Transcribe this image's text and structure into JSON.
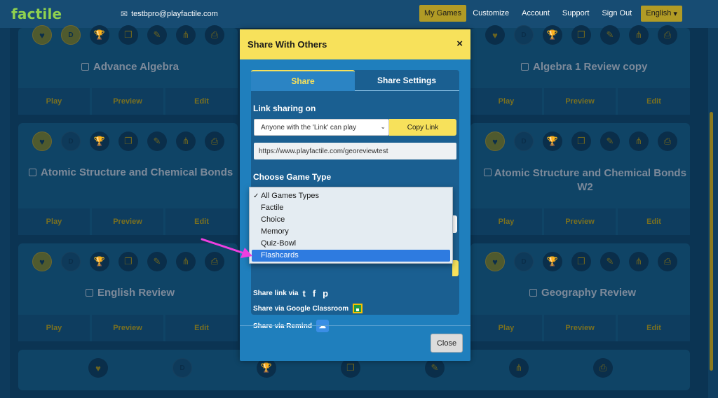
{
  "navbar": {
    "logo": "factile",
    "email": "testbpro@playfactile.com",
    "links": [
      "My Games",
      "Customize",
      "Account",
      "Support",
      "Sign Out"
    ],
    "language": "English"
  },
  "cards": {
    "col1": [
      "Advance Algebra",
      "Atomic Structure and Chemical Bonds",
      "English Review"
    ],
    "col3": [
      "Algebra 1 Review copy",
      "Atomic Structure and Chemical Bonds W2",
      "Geography Review"
    ],
    "actions": {
      "play": "Play",
      "preview": "Preview",
      "edit": "Edit"
    },
    "d_label": "D"
  },
  "modal": {
    "title": "Share With Others",
    "close_x": "×",
    "tabs": [
      "Share",
      "Share Settings"
    ],
    "link_sharing_label": "Link sharing on",
    "link_sharing_value": "Anyone with the 'Link' can play",
    "copy_link": "Copy Link",
    "url": "https://www.playfactile.com/georeviewtest",
    "choose_game_type": "Choose Game Type",
    "share_link_via": "Share link via",
    "share_google_classroom": "Share via Google Classroom",
    "share_remind": "Share via Remind",
    "close_button": "Close"
  },
  "game_type_dropdown": {
    "options": [
      "All Games Types",
      "Factile",
      "Choice",
      "Memory",
      "Quiz-Bowl",
      "Flashcards"
    ],
    "checked": "All Games Types",
    "highlighted": "Flashcards"
  },
  "colors": {
    "navbar": "#174c73",
    "accent_yellow": "#f7e15b",
    "modal_blue": "#1f7fbd",
    "highlight_blue": "#2e7be0",
    "arrow_magenta": "#ee3fe0"
  }
}
